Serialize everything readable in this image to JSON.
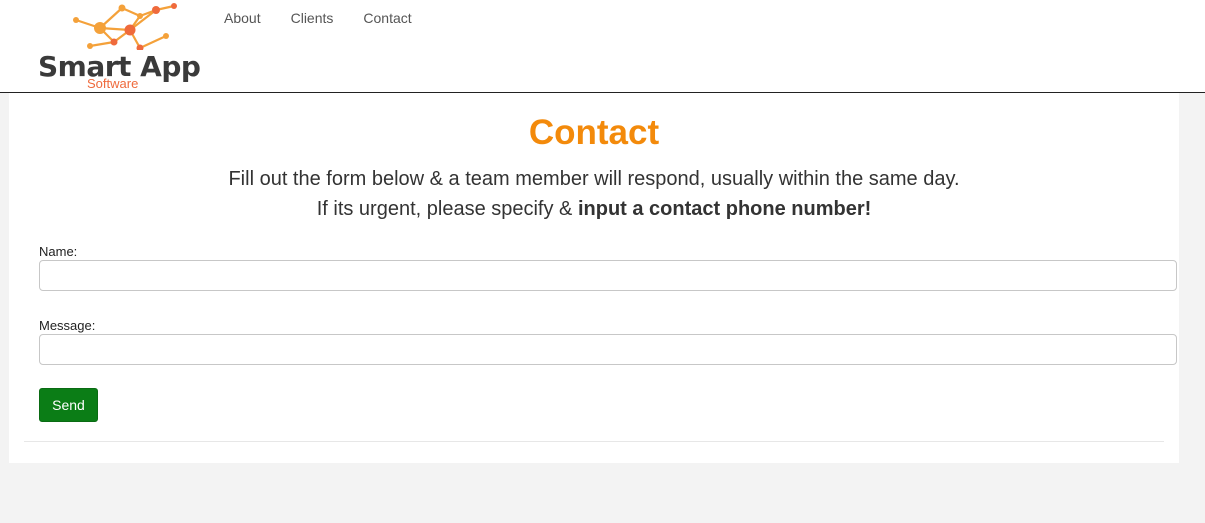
{
  "brand": {
    "title": "Smart App",
    "subtitle": "Software"
  },
  "nav": {
    "items": [
      {
        "label": "About"
      },
      {
        "label": "Clients"
      },
      {
        "label": "Contact"
      }
    ]
  },
  "main": {
    "title": "Contact",
    "intro_line1": "Fill out the form below & a team member will respond, usually within the same day.",
    "intro_line2_prefix": "If its urgent, please specify & ",
    "intro_line2_bold": "input a contact phone number!"
  },
  "form": {
    "name_label": "Name:",
    "name_value": "",
    "message_label": "Message:",
    "message_value": "",
    "send_label": "Send"
  },
  "colors": {
    "accent": "#f38a0b",
    "brand_sub": "#ef6a3c",
    "send_button": "#0b7d16",
    "page_bg": "#f3f3f3"
  },
  "icons": {
    "logo": "network-nodes-logo-icon"
  }
}
